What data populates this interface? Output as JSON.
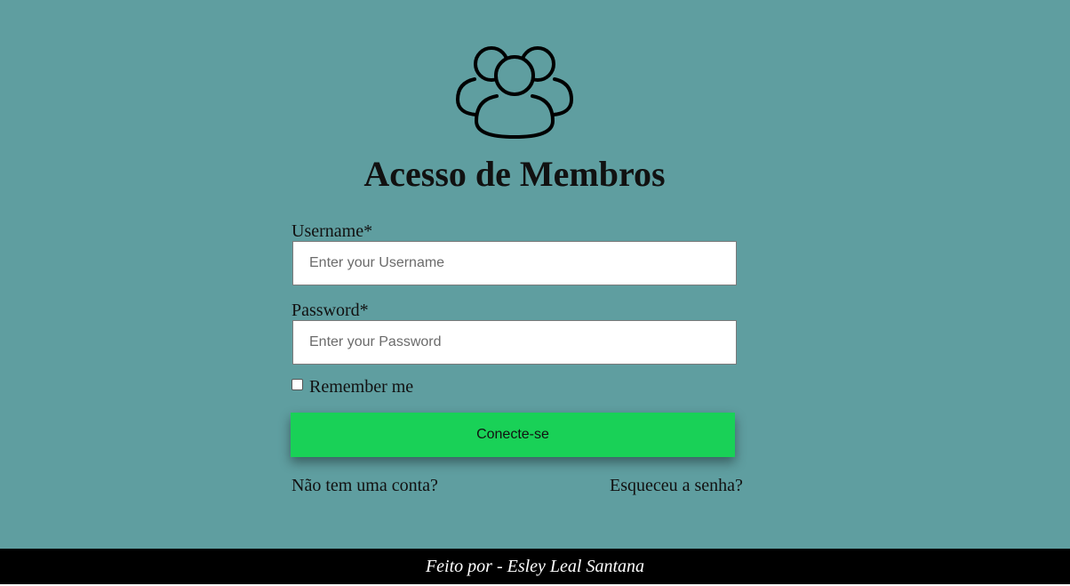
{
  "header": {
    "icon": "users-group-icon",
    "title": "Acesso de Membros"
  },
  "form": {
    "username": {
      "label": "Username*",
      "placeholder": "Enter your Username",
      "value": ""
    },
    "password": {
      "label": "Password*",
      "placeholder": "Enter your Password",
      "value": ""
    },
    "remember": {
      "label": "Remember me",
      "checked": false
    },
    "submit_label": "Conecte-se"
  },
  "links": {
    "signup": "Não tem uma conta?",
    "forgot": "Esqueceu a senha?"
  },
  "footer": {
    "text": "Feito por - Esley Leal Santana"
  },
  "colors": {
    "background": "#5f9ea0",
    "button": "#19d157",
    "footer": "#000000"
  }
}
